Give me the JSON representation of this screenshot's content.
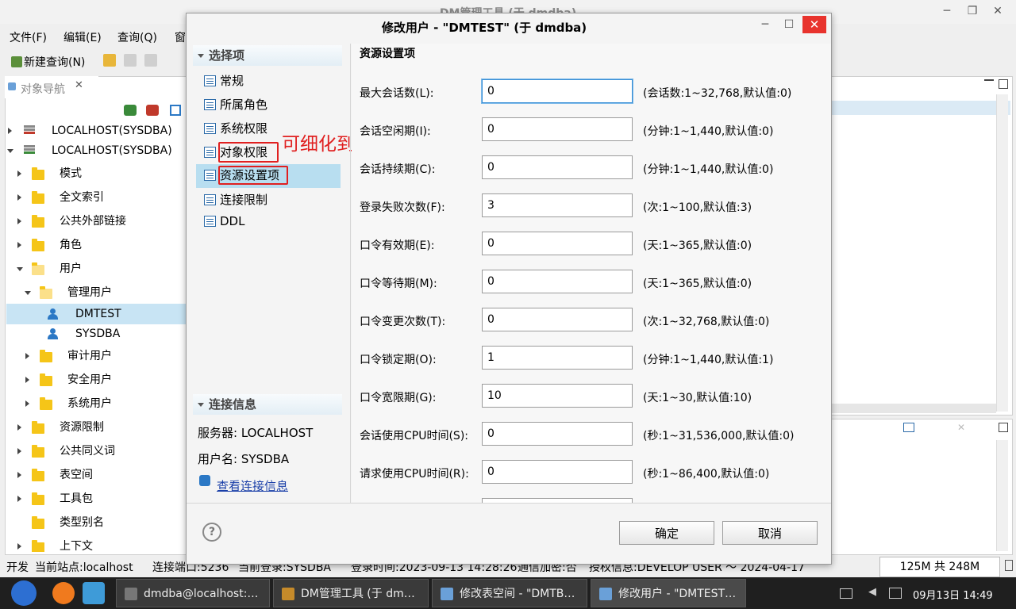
{
  "main_window": {
    "title": "DM管理工具 (于 dmdba)",
    "minimize": "─",
    "maximize": "❐",
    "close": "✕"
  },
  "menu": [
    "文件(F)",
    "编辑(E)",
    "查询(Q)",
    "窗"
  ],
  "toolbar": {
    "new_query": "新建查询(N)"
  },
  "nav": {
    "tab_label": "对象导航",
    "tab_close": "✕",
    "tree": [
      {
        "label": "LOCALHOST(SYSDBA)"
      },
      {
        "label": "LOCALHOST(SYSDBA)"
      },
      {
        "label": "模式"
      },
      {
        "label": "全文索引"
      },
      {
        "label": "公共外部链接"
      },
      {
        "label": "角色"
      },
      {
        "label": "用户"
      },
      {
        "label": "管理用户"
      },
      {
        "label": "DMTEST"
      },
      {
        "label": "SYSDBA"
      },
      {
        "label": "审计用户"
      },
      {
        "label": "安全用户"
      },
      {
        "label": "系统用户"
      },
      {
        "label": "资源限制"
      },
      {
        "label": "公共同义词"
      },
      {
        "label": "表空间"
      },
      {
        "label": "工具包"
      },
      {
        "label": "类型别名"
      },
      {
        "label": "上下文"
      }
    ]
  },
  "status": {
    "mode": "开发",
    "site": "当前站点:localhost",
    "port": "连接端口:5236",
    "login": "当前登录:SYSDBA",
    "login_time": "登录时间:2023-09-13 14:28:26",
    "encrypt": "通信加密:否",
    "license": "授权信息:DEVELOP USER ～ 2024-04-17",
    "memory": "125M 共 248M"
  },
  "taskbar": {
    "items": [
      "dmdba@localhost:…",
      "DM管理工具 (于 dm…",
      "修改表空间 - \"DMTB…",
      "修改用户 - \"DMTEST…"
    ],
    "clock": "09月13日 14:49"
  },
  "dialog": {
    "title": "修改用户 - \"DMTEST\" (于 dmdba)",
    "section_options": "选择项",
    "options": [
      "常规",
      "所属角色",
      "系统权限",
      "对象权限",
      "资源设置项",
      "连接限制",
      "DDL"
    ],
    "annotation": "可细化到列的访问控制",
    "section_conn": "连接信息",
    "server": "服务器: LOCALHOST",
    "user": "用户名: SYSDBA",
    "view_conn": "查看连接信息",
    "content_title": "资源设置项",
    "fields": [
      {
        "label": "最大会话数(L):",
        "value": "0",
        "hint": "(会话数:1~32,768,默认值:0)"
      },
      {
        "label": "会话空闲期(I):",
        "value": "0",
        "hint": "(分钟:1~1,440,默认值:0)"
      },
      {
        "label": "会话持续期(C):",
        "value": "0",
        "hint": "(分钟:1~1,440,默认值:0)"
      },
      {
        "label": "登录失败次数(F):",
        "value": "3",
        "hint": "(次:1~100,默认值:3)"
      },
      {
        "label": "口令有效期(E):",
        "value": "0",
        "hint": "(天:1~365,默认值:0)"
      },
      {
        "label": "口令等待期(M):",
        "value": "0",
        "hint": "(天:1~365,默认值:0)"
      },
      {
        "label": "口令变更次数(T):",
        "value": "0",
        "hint": "(次:1~32,768,默认值:0)"
      },
      {
        "label": "口令锁定期(O):",
        "value": "1",
        "hint": "(分钟:1~1,440,默认值:1)"
      },
      {
        "label": "口令宽限期(G):",
        "value": "10",
        "hint": "(天:1~30,默认值:10)"
      },
      {
        "label": "会话使用CPU时间(S):",
        "value": "0",
        "hint": "(秒:1~31,536,000,默认值:0)"
      },
      {
        "label": "请求使用CPU时间(R):",
        "value": "0",
        "hint": "(秒:1~86,400,默认值:0)"
      }
    ],
    "help": "?",
    "ok": "确定",
    "cancel": "取消"
  }
}
